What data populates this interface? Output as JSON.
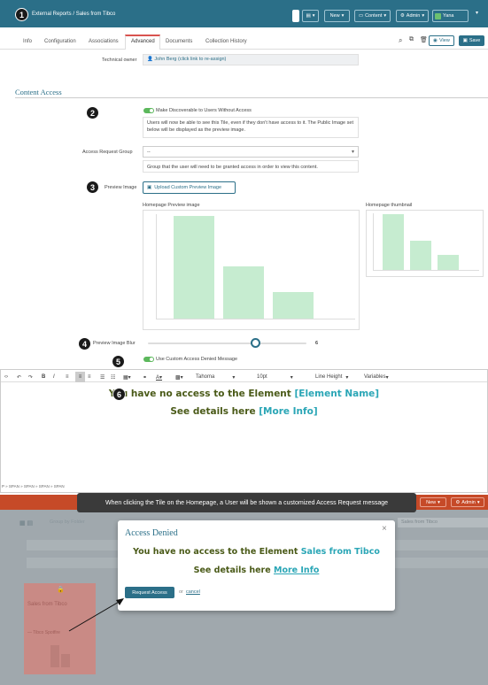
{
  "header": {
    "breadcrumb": "External Reports / Sales from Tibco",
    "new_label": "New",
    "content_label": "Content",
    "admin_label": "Admin",
    "user_label": "Yana"
  },
  "tabs": [
    {
      "label": "Info"
    },
    {
      "label": "Configuration"
    },
    {
      "label": "Associations"
    },
    {
      "label": "Advanced"
    },
    {
      "label": "Documents"
    },
    {
      "label": "Collection History"
    }
  ],
  "actions": {
    "view_label": "View",
    "save_label": "Save"
  },
  "owner": {
    "label": "Technical owner",
    "value": "John Berg (click link to re-assign)"
  },
  "content_access": {
    "title": "Content Access",
    "discoverable_label": "Make Discoverable to Users Without Access",
    "discoverable_help": "Users will now be able to see this Tile, even if they don't have access to it. The Public Image set below will be displayed as the preview image.",
    "request_group_label": "Access Request Group",
    "request_group_value": "--",
    "request_group_help": "Group that the user will need to be granted access in order to view this content.",
    "preview_image_label": "Preview Image",
    "upload_label": "Upload Custom Preview Image",
    "homepage_preview_label": "Homepage Preview image",
    "homepage_thumb_label": "Homepage thumbnail",
    "blur_label": "Preview Image Blur",
    "blur_value": "6",
    "blur_fraction": 0.6,
    "custom_msg_label": "Use Custom Access Denied Message"
  },
  "editor": {
    "font": "Tahoma",
    "size": "10pt",
    "line_height": "Line Height",
    "variables": "Variables",
    "line1_prefix": "You have no access to the Element ",
    "line1_var": "[Element Name]",
    "line2_prefix": "See details here ",
    "line2_var": "[More Info]",
    "path": "P » SPAN » SPAN » SPAN » SPAN"
  },
  "tooltip": "When clicking the Tile on the Homepage, a User will be shown a customized Access Request message",
  "lower": {
    "new_label": "New",
    "admin_label": "Admin",
    "group_placeholder": "Group by Folder",
    "search_placeholder": "Sales from Tibco",
    "tile_title": "Sales from Tibco",
    "tile_sub": "— Tibco Spotfire"
  },
  "modal": {
    "title": "Access Denied",
    "line1_prefix": "You have no access to the Element ",
    "line1_highlight": "Sales from Tibco",
    "line2_prefix": "See details here ",
    "line2_link": "More Info",
    "button": "Request Access",
    "or": "or",
    "cancel": "cancel"
  },
  "badges": [
    "1",
    "2",
    "3",
    "4",
    "5",
    "6"
  ],
  "colors": {
    "brand": "#2b6f88",
    "accent": "#d9534f",
    "bar": "#c6ecd0",
    "var_text": "#2aa6b6"
  }
}
